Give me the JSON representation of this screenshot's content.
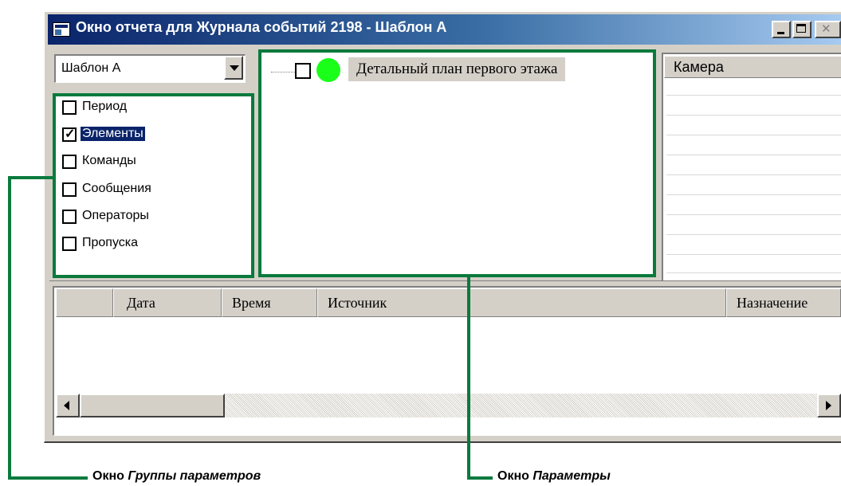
{
  "window": {
    "title": "Окно отчета для Журнала событий 2198 - Шаблон А"
  },
  "template_select": {
    "value": "Шаблон А"
  },
  "groups": {
    "items": [
      {
        "label": "Период",
        "checked": false
      },
      {
        "label": "Элементы",
        "checked": true
      },
      {
        "label": "Команды",
        "checked": false
      },
      {
        "label": "Сообщения",
        "checked": false
      },
      {
        "label": "Операторы",
        "checked": false
      },
      {
        "label": "Пропуска",
        "checked": false
      }
    ]
  },
  "params": {
    "tree_item": {
      "label": "Детальный план первого этажа",
      "status_color": "#1aff1a"
    }
  },
  "camera_list": {
    "header": "Камера"
  },
  "events_table": {
    "columns": [
      "",
      "Дата",
      "Время",
      "Источник",
      "Назначение"
    ]
  },
  "callouts": {
    "groups_prefix": "Окно ",
    "groups_name": "Группы параметров",
    "params_prefix": "Окно ",
    "params_name": "Параметры"
  },
  "colors": {
    "accent_green": "#0a7a3d",
    "title_blue": "#0a246a"
  }
}
